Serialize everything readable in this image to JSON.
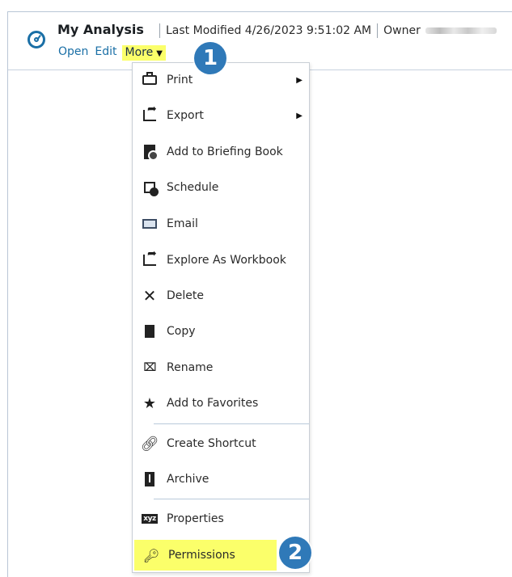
{
  "header": {
    "title": "My Analysis",
    "last_modified": "Last Modified 4/26/2023 9:51:02 AM",
    "owner_label": "Owner",
    "icon": "gauge-icon"
  },
  "actions": {
    "open": "Open",
    "edit": "Edit",
    "more": "More",
    "more_caret": "▼"
  },
  "badges": {
    "first": "1",
    "second": "2",
    "color": "#2f79b8"
  },
  "highlight_color": "#fbff6a",
  "menu": {
    "items": [
      {
        "label": "Print",
        "icon": "printer-icon",
        "submenu": "▶"
      },
      {
        "label": "Export",
        "icon": "export-icon",
        "submenu": "▶"
      },
      {
        "label": "Add to Briefing Book",
        "icon": "briefing-book-icon"
      },
      {
        "label": "Schedule",
        "icon": "schedule-icon"
      },
      {
        "label": "Email",
        "icon": "email-icon"
      },
      {
        "label": "Explore As Workbook",
        "icon": "explore-workbook-icon"
      },
      {
        "label": "Delete",
        "icon": "delete-x-icon"
      },
      {
        "label": "Copy",
        "icon": "copy-icon"
      },
      {
        "label": "Rename",
        "icon": "rename-icon"
      },
      {
        "label": "Add to Favorites",
        "icon": "favorites-star-icon"
      },
      {
        "label": "Create Shortcut",
        "icon": "shortcut-link-icon"
      },
      {
        "label": "Archive",
        "icon": "archive-icon"
      },
      {
        "label": "Properties",
        "icon": "properties-icon",
        "icon_text": "xyz"
      },
      {
        "label": "Permissions",
        "icon": "permissions-key-icon"
      }
    ]
  }
}
